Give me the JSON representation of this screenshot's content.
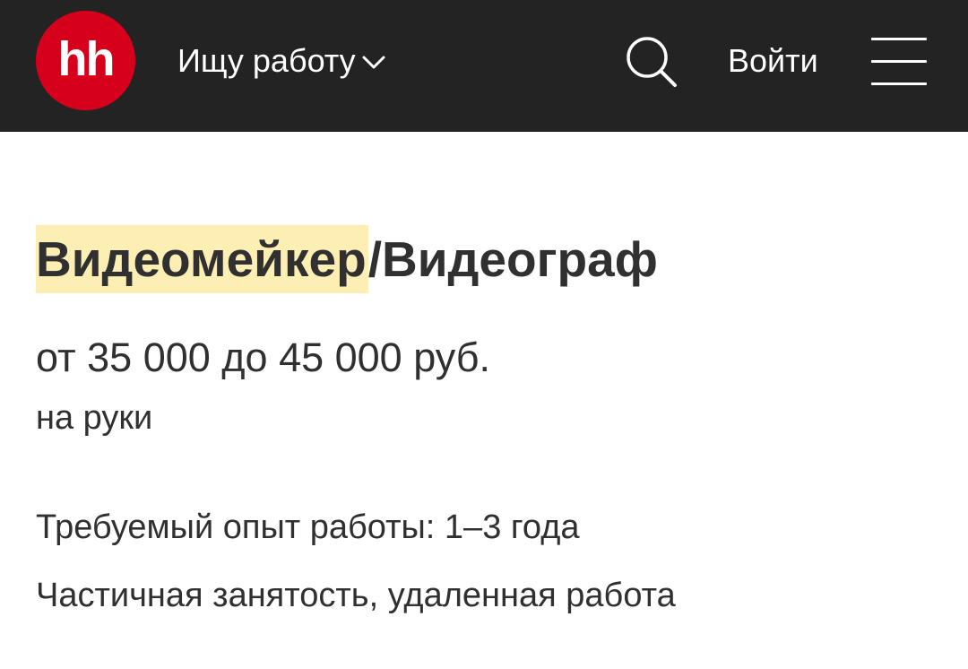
{
  "header": {
    "logo_text": "hh",
    "mode_label": "Ищу работу",
    "login_label": "Войти",
    "icons": {
      "mode_dropdown": "chevron-down-icon",
      "search": "search-icon",
      "menu": "hamburger-menu-icon"
    },
    "colors": {
      "background": "#232323",
      "logo": "#d6001c",
      "text": "#ffffff"
    }
  },
  "vacancy": {
    "title_highlight": "Видеомейкер",
    "title_rest": "/Видеограф",
    "salary": "от 35 000 до 45 000 руб.",
    "salary_note": "на руки",
    "experience": "Требуемый опыт работы: 1–3 года",
    "employment": "Частичная занятость, удаленная работа",
    "colors": {
      "highlight": "#fdeeb3",
      "text": "#303030"
    }
  }
}
